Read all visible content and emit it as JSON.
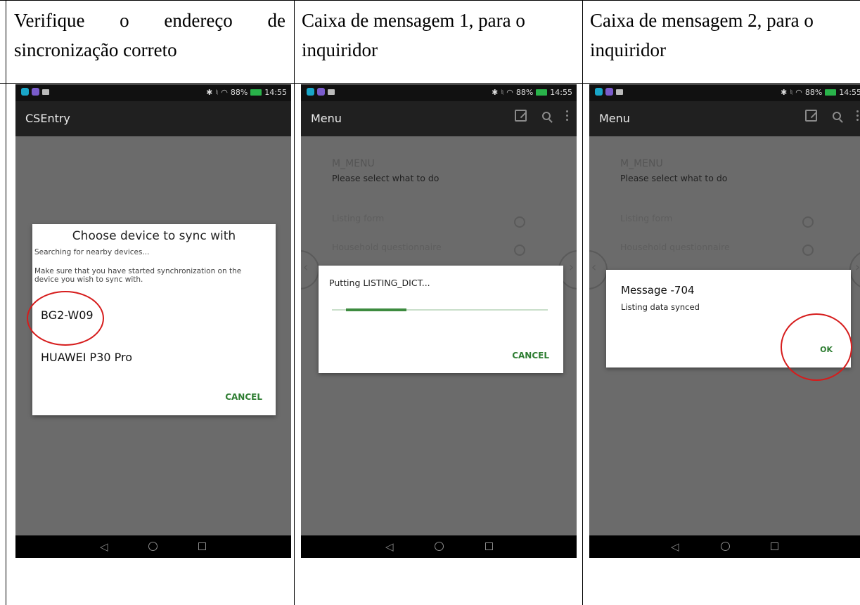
{
  "headers": [
    {
      "line1": [
        "Verifique",
        "o",
        "endereço",
        "de"
      ],
      "line2": "sincronização correto"
    },
    {
      "line1": [
        "Caixa de mensagem 1, para o"
      ],
      "line2": "inquiridor"
    },
    {
      "line1": [
        "Caixa de mensagem 2, para o"
      ],
      "line2": "inquiridor"
    }
  ],
  "status_bar": {
    "battery": "88%",
    "time": "14:55"
  },
  "screen1": {
    "app_title": "CSEntry",
    "dialog": {
      "title": "Choose device to sync with",
      "searching": "Searching for nearby devices...",
      "instructions": "Make sure that you have started synchronization on the device you wish to sync with.",
      "devices": [
        "BG2-W09",
        "HUAWEI P30 Pro"
      ],
      "cancel": "CANCEL"
    }
  },
  "screen2": {
    "app_title": "Menu",
    "form": {
      "heading": "M_MENU",
      "prompt": "Please select what to do",
      "options": [
        "Listing form",
        "Household questionnaire"
      ]
    },
    "dialog": {
      "message": "Putting LISTING_DICT...",
      "progress": 0.33,
      "cancel": "CANCEL"
    }
  },
  "screen3": {
    "app_title": "Menu",
    "form": {
      "heading": "M_MENU",
      "prompt": "Please select what to do",
      "options": [
        "Listing form",
        "Household questionnaire"
      ]
    },
    "dialog": {
      "title": "Message -704",
      "body": "Listing data synced",
      "ok": "OK"
    }
  },
  "icons": {
    "status_left": [
      "app-notification-icon",
      "app-notification-icon",
      "mail-icon"
    ],
    "status_right": [
      "bluetooth-icon",
      "nfc-icon",
      "wifi-icon",
      "battery-icon"
    ],
    "appbar_actions": [
      "edit-icon",
      "search-icon",
      "more-vert-icon"
    ],
    "navigation": [
      "back-icon",
      "home-icon",
      "recents-icon"
    ]
  },
  "colors": {
    "accent_green": "#2e7d32",
    "highlight_red": "#d61c1c",
    "progress_green": "#3d8b3f"
  }
}
